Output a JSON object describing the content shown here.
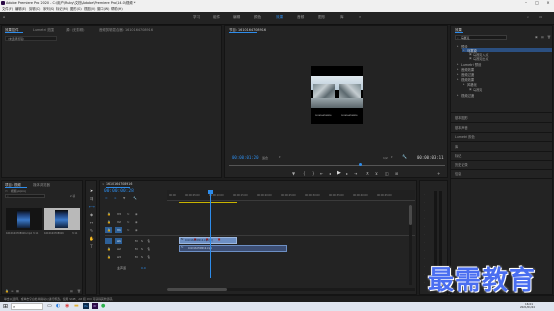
{
  "window": {
    "title": "Adobe Premiere Pro 2020 - C:\\用户\\Ruby\\文档\\Adobe\\Premiere Pro\\14.0\\视频 *"
  },
  "menu": [
    "文件(F)",
    "编辑(E)",
    "剪辑(C)",
    "序列(S)",
    "标记(M)",
    "图形(G)",
    "视图(V)",
    "窗口(W)",
    "帮助(H)"
  ],
  "workspaces": {
    "items": [
      "学习",
      "组件",
      "编辑",
      "颜色",
      "效果",
      "音频",
      "图形",
      "库"
    ],
    "active_index": 4
  },
  "source_panel": {
    "tabs": [
      "效果控件",
      "Lumetri 范围",
      "源: (无剪辑)",
      "音频剪辑混合器: 1610164708916"
    ],
    "message": "(未选择剪辑)"
  },
  "program_monitor": {
    "title": "节目: 1610164708916",
    "timecode_left": "00:00:01:20",
    "fit": "适合",
    "quality": "1/2",
    "timecode_right": "00:00:03:11",
    "preview_captions": [
      "1610164708916",
      "1610164708916"
    ]
  },
  "effects_panel": {
    "title": "效果",
    "search": "马赛克",
    "presets": "预设",
    "items": [
      {
        "label": "Lumetri 预设",
        "depth": 0
      },
      {
        "label": "音频效果",
        "depth": 0
      },
      {
        "label": "音频过渡",
        "depth": 0
      },
      {
        "label": "视频效果",
        "depth": 0
      },
      {
        "label": "风格化",
        "depth": 1
      },
      {
        "label": "马赛克",
        "depth": 2
      },
      {
        "label": "视频过渡",
        "depth": 0
      }
    ],
    "preset_children": [
      "马赛克入点",
      "马赛克出点"
    ],
    "side_sections": [
      "基本图形",
      "基本声音",
      "Lumetri 颜色",
      "库",
      "标记",
      "历史记录",
      "信息"
    ]
  },
  "project_panel": {
    "tabs": [
      "项目: 视频",
      "媒体浏览器"
    ],
    "file": "视频.prproj",
    "item_count": "2 项",
    "clips": [
      {
        "name": "1610164708916.mp4",
        "duration": "3:11"
      },
      {
        "name": "1610164708916",
        "duration": "3:11"
      }
    ]
  },
  "timeline": {
    "sequence": "1610164708916",
    "timecode": "00:00:00:28",
    "ruler": [
      "00:00",
      "00:00:05:00",
      "00:00:10:00",
      "00:00:15:00",
      "00:00:20:00",
      "00:00:25:00",
      "00:00:30:00",
      "00:00:35:00",
      "00:00:40:00",
      "00:00:45:00"
    ],
    "video_tracks": [
      "V3",
      "V2",
      "V1"
    ],
    "audio_tracks": [
      "A1",
      "A2",
      "A3"
    ],
    "master": "主声道",
    "master_value": "0.0",
    "clip_label": "1610164708916.mp4 [V]",
    "audio_clip_label": "1610164708916.mp4"
  },
  "status": {
    "message": "单击以选择，或单击空白处并拖动以进行框选。使用 Shift、Alt 和 Ctrl 可获得其他选项。"
  },
  "taskbar": {
    "time": "16:01",
    "date": "2021/01/24"
  },
  "watermark": "最需教育"
}
